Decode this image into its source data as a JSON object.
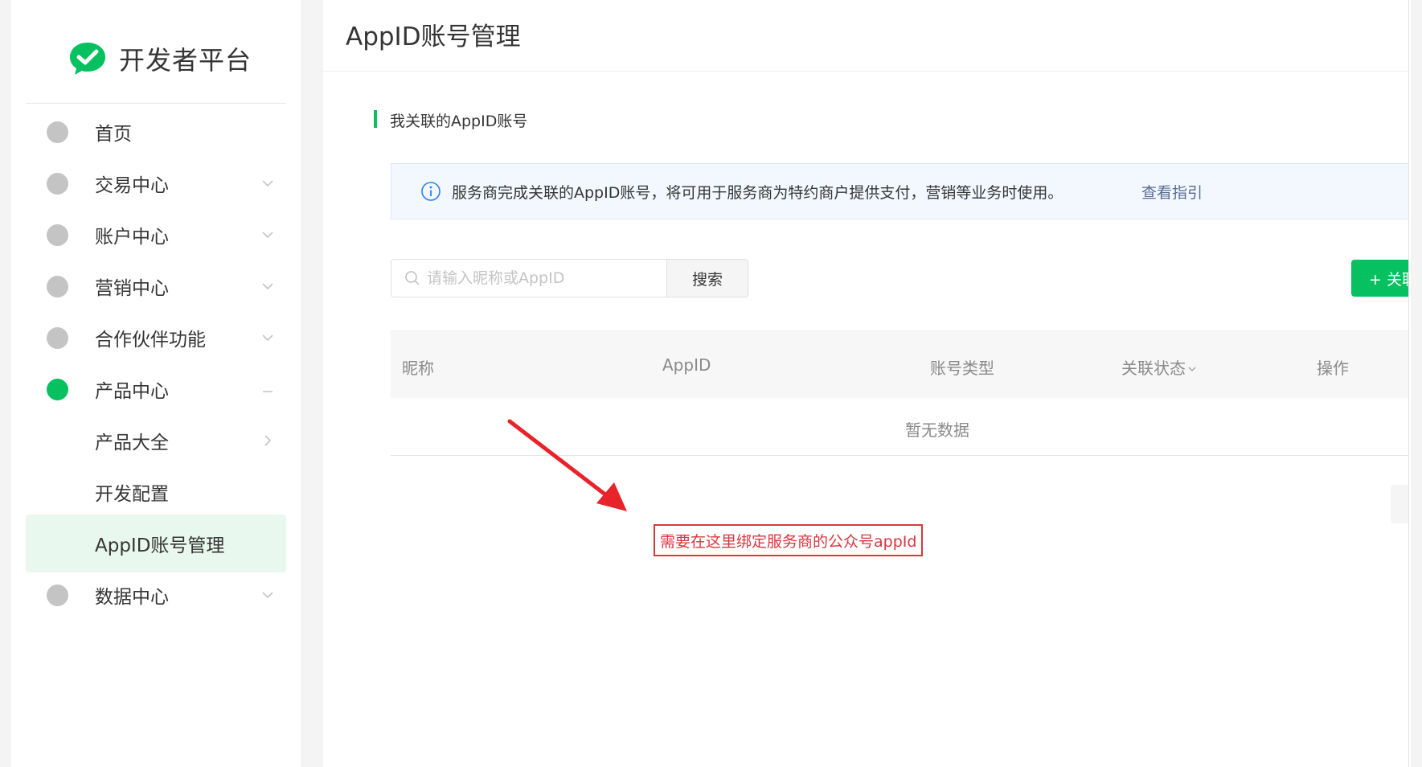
{
  "brand": {
    "name": "开发者平台",
    "logo_icon": "wechat-check-icon",
    "accent": "#07c160"
  },
  "sidebar": {
    "items": [
      {
        "label": "首页",
        "icon": "dot-icon",
        "arrow": ""
      },
      {
        "label": "交易中心",
        "icon": "dot-icon",
        "arrow": "chevron-down-icon"
      },
      {
        "label": "账户中心",
        "icon": "dot-icon",
        "arrow": "chevron-down-icon"
      },
      {
        "label": "营销中心",
        "icon": "dot-icon",
        "arrow": "chevron-down-icon"
      },
      {
        "label": "合作伙伴功能",
        "icon": "dot-icon",
        "arrow": "chevron-down-icon"
      },
      {
        "label": "产品中心",
        "icon": "dot-icon-active",
        "arrow": "collapse-dash-icon"
      },
      {
        "label": "产品大全",
        "icon": "",
        "arrow": "chevron-right-icon"
      },
      {
        "label": "开发配置",
        "icon": "",
        "arrow": ""
      },
      {
        "label": "AppID账号管理",
        "icon": "",
        "arrow": "",
        "selected": true
      },
      {
        "label": "数据中心",
        "icon": "dot-icon",
        "arrow": "chevron-down-icon"
      }
    ]
  },
  "main": {
    "title": "AppID账号管理",
    "section_title": "我关联的AppID账号",
    "notice": {
      "text": "服务商完成关联的AppID账号，将可用于服务商为特约商户提供支付，营销等业务时使用。",
      "link": "查看指引"
    },
    "search": {
      "placeholder": "请输入昵称或AppID",
      "value": "",
      "button": "搜索"
    },
    "add_button": "+ 关联AppID",
    "table": {
      "columns": [
        "昵称",
        "AppID",
        "账号类型",
        "关联状态",
        "操作"
      ],
      "empty_text": "暂无数据"
    }
  },
  "annotation": {
    "text": "需要在这里绑定服务商的公众号appId",
    "color": "#d9363e"
  }
}
